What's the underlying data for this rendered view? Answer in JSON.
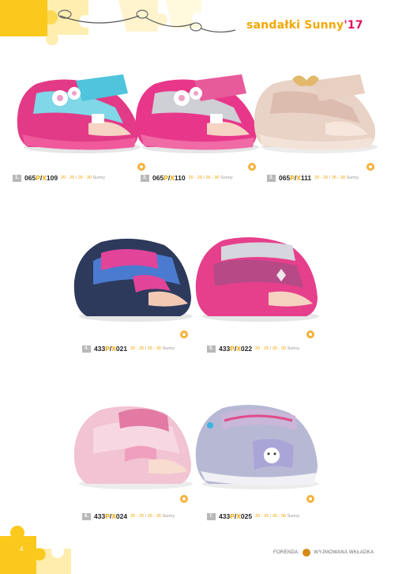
{
  "header": {
    "title": "sandałki Sunny",
    "year": "'17"
  },
  "products": [
    {
      "index": "1.",
      "code_prefix": "065",
      "code_p": "P",
      "code_sep": "/",
      "code_x": "X",
      "code_suffix": "109",
      "sizes_a": "20 - 25",
      "sizes_sep": " / ",
      "sizes_b": "26 - 30",
      "sizes_name": " Sunny",
      "icon": "insole-icon"
    },
    {
      "index": "2.",
      "code_prefix": "065",
      "code_p": "P",
      "code_sep": "/",
      "code_x": "X",
      "code_suffix": "110",
      "sizes_a": "20 - 25",
      "sizes_sep": " / ",
      "sizes_b": "26 - 30",
      "sizes_name": " Sunny",
      "icon": "insole-icon"
    },
    {
      "index": "3.",
      "code_prefix": "065",
      "code_p": "P",
      "code_sep": "/",
      "code_x": "X",
      "code_suffix": "111",
      "sizes_a": "20 - 25",
      "sizes_sep": " / ",
      "sizes_b": "26 - 30",
      "sizes_name": " Sunny",
      "icon": "insole-icon"
    },
    {
      "index": "4.",
      "code_prefix": "433",
      "code_p": "P",
      "code_sep": "/",
      "code_x": "X",
      "code_suffix": "021",
      "sizes_a": "20 - 25",
      "sizes_sep": " / ",
      "sizes_b": "26 - 30",
      "sizes_name": " Sunny",
      "icon": "insole-icon"
    },
    {
      "index": "5.",
      "code_prefix": "433",
      "code_p": "P",
      "code_sep": "/",
      "code_x": "X",
      "code_suffix": "022",
      "sizes_a": "20 - 25",
      "sizes_sep": " / ",
      "sizes_b": "26 - 30",
      "sizes_name": " Sunny",
      "icon": "insole-icon"
    },
    {
      "index": "6.",
      "code_prefix": "433",
      "code_p": "P",
      "code_sep": "/",
      "code_x": "X",
      "code_suffix": "024",
      "sizes_a": "20 - 25",
      "sizes_sep": " / ",
      "sizes_b": "26 - 30",
      "sizes_name": " Sunny",
      "icon": "insole-icon"
    },
    {
      "index": "7.",
      "code_prefix": "433",
      "code_p": "P",
      "code_sep": "/",
      "code_x": "X",
      "code_suffix": "025",
      "sizes_a": "20 - 25",
      "sizes_sep": " / ",
      "sizes_b": "26 - 30",
      "sizes_name": " Sunny",
      "icon": "insole-icon"
    }
  ],
  "footer": {
    "page_number": "4",
    "legend_label": "FORENDA:",
    "legend_text": "WYJMOWANA WKŁADKA"
  },
  "colors": {
    "accent_yellow": "#f1a800",
    "accent_pink": "#e0135f",
    "puzzle_yellow": "#fbc81c"
  }
}
